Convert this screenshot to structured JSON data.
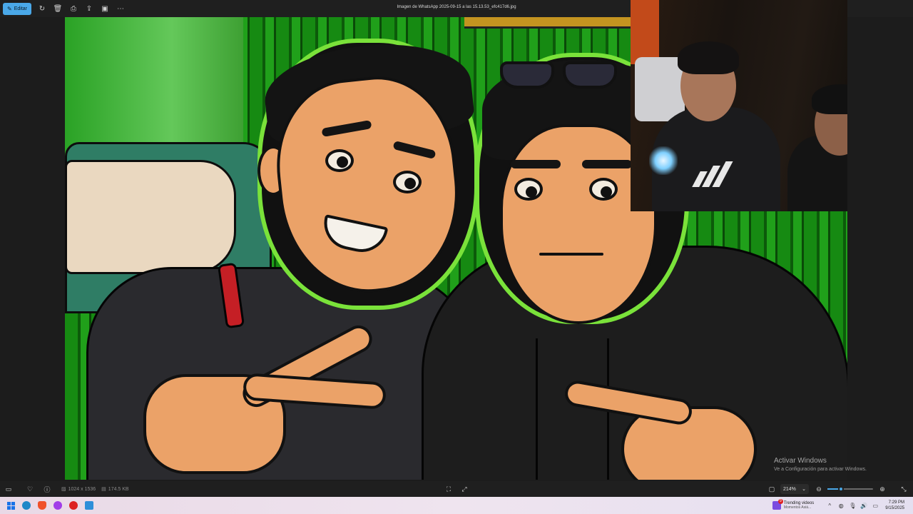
{
  "window": {
    "title": "Imagen de WhatsApp 2025-09-15 a las 15.13.53_efc417d6.jpg"
  },
  "toolbar": {
    "edit_label": "Editar",
    "icons": [
      "edit-icon",
      "rotate-icon",
      "delete-icon",
      "print-icon",
      "share-icon",
      "slideshow-icon",
      "more-icon"
    ]
  },
  "status": {
    "dimensions": "1024 x 1536",
    "file_size": "174.5 KB",
    "zoom": "214%",
    "zoom_level_fraction": 0.3
  },
  "watermark": {
    "title": "Activar Windows",
    "subtitle": "Ve a Configuración para activar Windows."
  },
  "taskbar": {
    "trending_title": "Trending videos",
    "trending_subtitle": "Momentos Asiá...",
    "time": "7:29 PM",
    "date": "9/15/2025",
    "notification_count": "9"
  },
  "colors": {
    "accent": "#4aa8e8",
    "outline_green": "#7ae23a",
    "toolbar_bg": "#1f1f1f"
  }
}
